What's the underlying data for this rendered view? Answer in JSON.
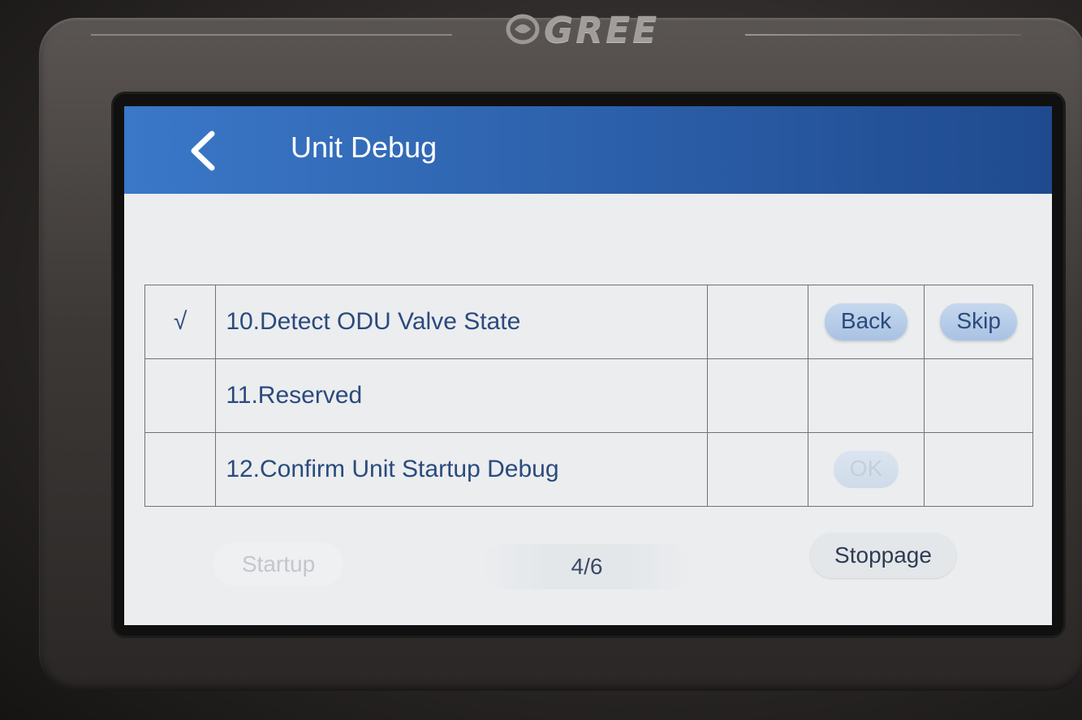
{
  "device": {
    "brand": "GREE"
  },
  "header": {
    "title": "Unit Debug"
  },
  "steps": [
    {
      "check": "√",
      "label": "10.Detect ODU Valve State",
      "actions": [
        "Back",
        "Skip"
      ]
    },
    {
      "check": "",
      "label": "11.Reserved",
      "actions": []
    },
    {
      "check": "",
      "label": "12.Confirm Unit Startup Debug",
      "actions": [
        "OK"
      ]
    }
  ],
  "footer": {
    "startup_label": "Startup",
    "page_indicator": "4/6",
    "stoppage_label": "Stoppage"
  },
  "colors": {
    "header_blue": "#2e63ae",
    "button_blue": "#b3c9e5",
    "text_navy": "#2b4a7d"
  }
}
